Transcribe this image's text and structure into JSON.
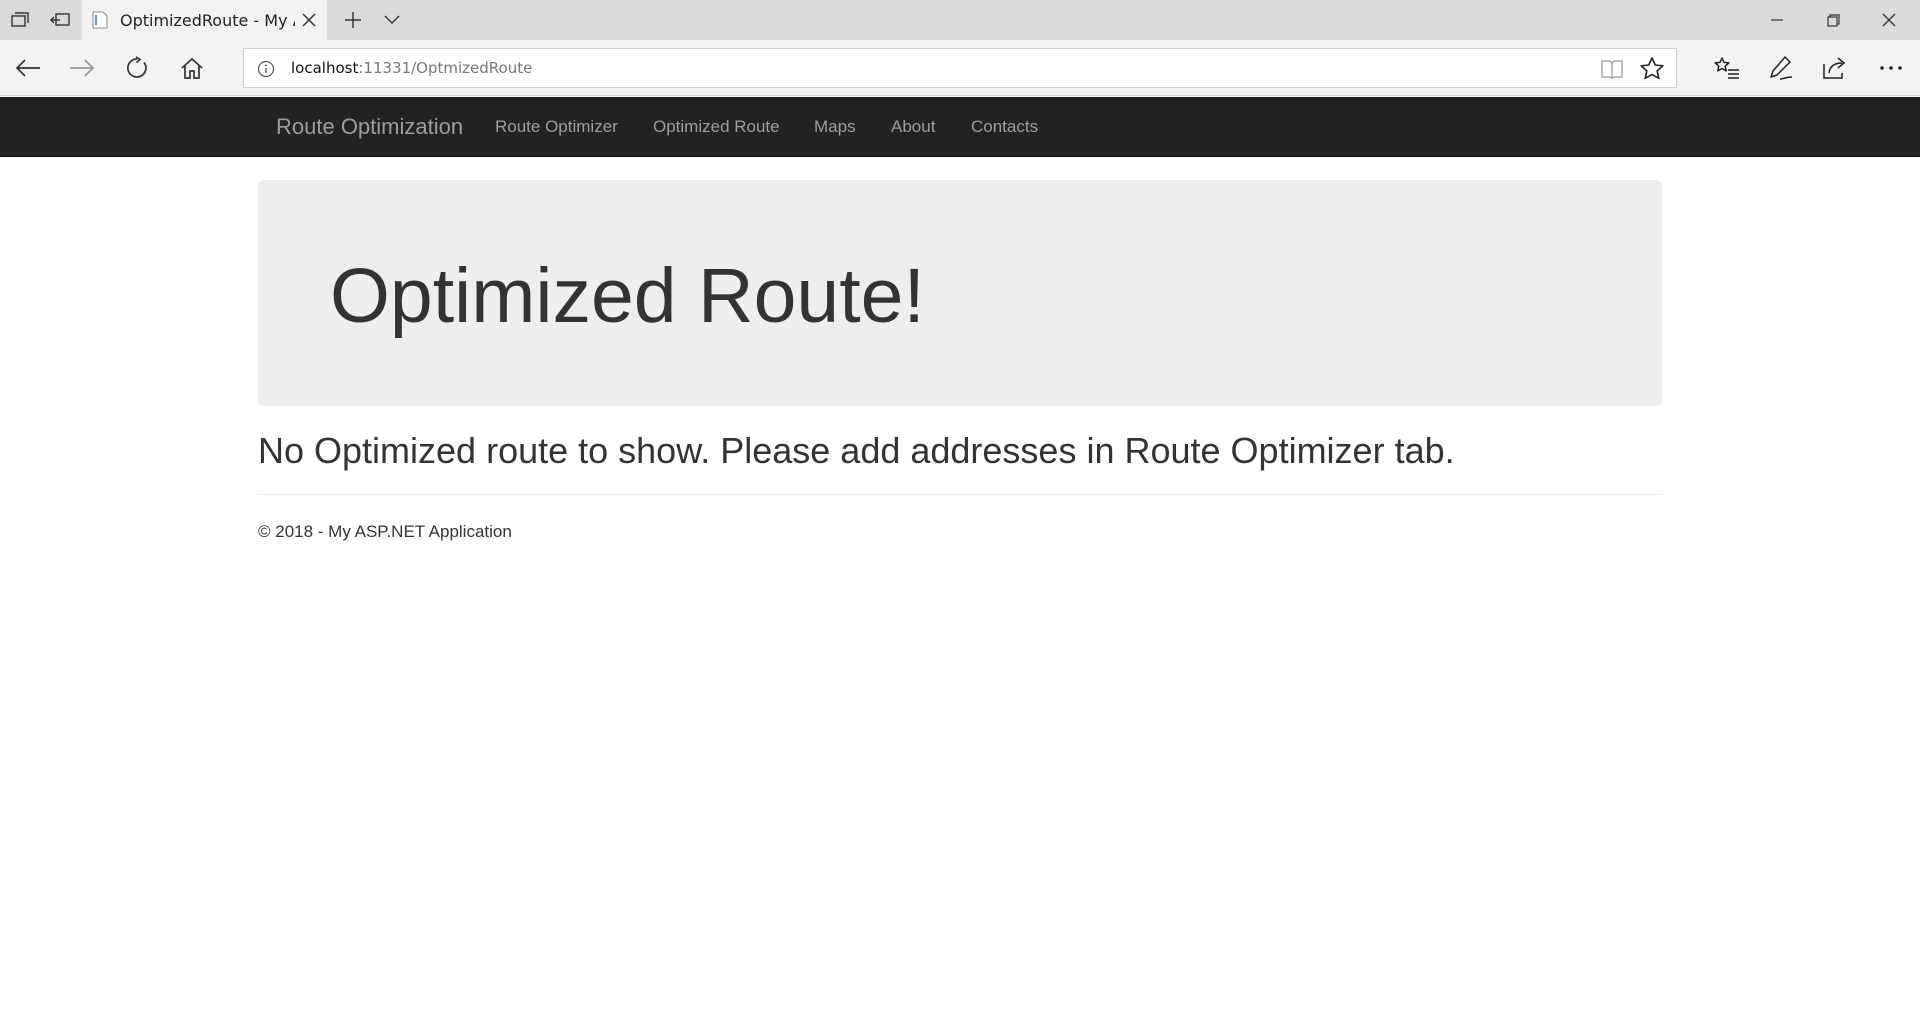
{
  "browser": {
    "tab_title": "OptimizedRoute - My A",
    "url_host": "localhost",
    "url_rest": ":11331/OptmizedRoute"
  },
  "site": {
    "brand": "Route Optimization",
    "nav": [
      {
        "label": "Route Optimizer"
      },
      {
        "label": "Optimized Route"
      },
      {
        "label": "Maps"
      },
      {
        "label": "About"
      },
      {
        "label": "Contacts"
      }
    ]
  },
  "page": {
    "heading": "Optimized Route!",
    "message": "No Optimized route to show. Please add addresses in Route Optimizer tab.",
    "footer": "© 2018 - My ASP.NET Application"
  },
  "colors": {
    "navbar_bg": "#222222",
    "navbar_text": "#9d9d9d",
    "jumbotron_bg": "#eeeeee",
    "text": "#333333"
  }
}
